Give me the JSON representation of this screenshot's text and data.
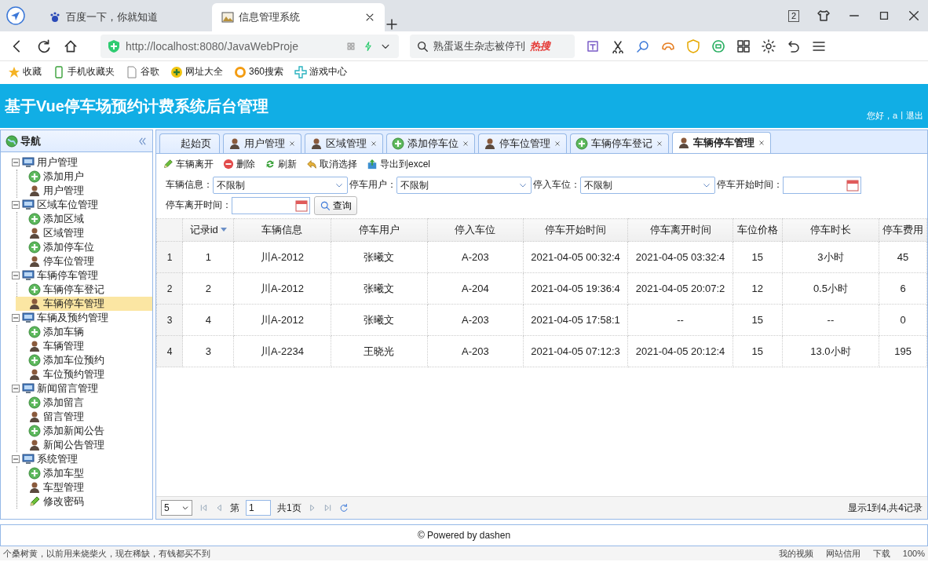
{
  "browser": {
    "tabs": [
      {
        "title": "百度一下，你就知道",
        "selected": false,
        "kind": "paw"
      },
      {
        "title": "信息管理系统",
        "selected": true,
        "kind": "picture"
      }
    ],
    "window_count": "2",
    "url": "http://localhost:8080/JavaWebProje",
    "search_hint": "熟蛋返生杂志被停刊",
    "hot": "热搜",
    "bookmarks": [
      {
        "label": "收藏",
        "kind": "star"
      },
      {
        "label": "手机收藏夹",
        "kind": "phone"
      },
      {
        "label": "谷歌",
        "kind": "page"
      },
      {
        "label": "网址大全",
        "kind": "plus"
      },
      {
        "label": "360搜索",
        "kind": "ring"
      },
      {
        "label": "游戏中心",
        "kind": "cross"
      }
    ]
  },
  "app": {
    "title": "基于Vue停车场预约计费系统后台管理",
    "greeting": "您好，a",
    "separator": "|",
    "logout": "退出"
  },
  "nav": {
    "title": "导航",
    "groups": [
      {
        "label": "用户管理",
        "expanded": true,
        "children": [
          {
            "label": "添加用户",
            "kind": "add",
            "selected": false
          },
          {
            "label": "用户管理",
            "kind": "user",
            "selected": false
          }
        ]
      },
      {
        "label": "区域车位管理",
        "expanded": true,
        "children": [
          {
            "label": "添加区域",
            "kind": "add",
            "selected": false
          },
          {
            "label": "区域管理",
            "kind": "user",
            "selected": false
          },
          {
            "label": "添加停车位",
            "kind": "add",
            "selected": false
          },
          {
            "label": "停车位管理",
            "kind": "user",
            "selected": false
          }
        ]
      },
      {
        "label": "车辆停车管理",
        "expanded": true,
        "children": [
          {
            "label": "车辆停车登记",
            "kind": "add",
            "selected": false
          },
          {
            "label": "车辆停车管理",
            "kind": "user",
            "selected": true
          }
        ]
      },
      {
        "label": "车辆及预约管理",
        "expanded": true,
        "children": [
          {
            "label": "添加车辆",
            "kind": "add",
            "selected": false
          },
          {
            "label": "车辆管理",
            "kind": "user",
            "selected": false
          },
          {
            "label": "添加车位预约",
            "kind": "add",
            "selected": false
          },
          {
            "label": "车位预约管理",
            "kind": "user",
            "selected": false
          }
        ]
      },
      {
        "label": "新闻留言管理",
        "expanded": true,
        "children": [
          {
            "label": "添加留言",
            "kind": "add",
            "selected": false
          },
          {
            "label": "留言管理",
            "kind": "user",
            "selected": false
          },
          {
            "label": "添加新闻公告",
            "kind": "add",
            "selected": false
          },
          {
            "label": "新闻公告管理",
            "kind": "user",
            "selected": false
          }
        ]
      },
      {
        "label": "系统管理",
        "expanded": true,
        "children": [
          {
            "label": "添加车型",
            "kind": "add",
            "selected": false
          },
          {
            "label": "车型管理",
            "kind": "user",
            "selected": false
          },
          {
            "label": "修改密码",
            "kind": "edit",
            "selected": false
          }
        ]
      }
    ]
  },
  "tabs": [
    {
      "label": "起始页",
      "kind": "home",
      "selected": false
    },
    {
      "label": "用户管理",
      "kind": "user",
      "selected": false
    },
    {
      "label": "区域管理",
      "kind": "user",
      "selected": false
    },
    {
      "label": "添加停车位",
      "kind": "add",
      "selected": false
    },
    {
      "label": "停车位管理",
      "kind": "user",
      "selected": false
    },
    {
      "label": "车辆停车登记",
      "kind": "add",
      "selected": false
    },
    {
      "label": "车辆停车管理",
      "kind": "user",
      "selected": true
    }
  ],
  "toolbar": [
    {
      "label": "车辆离开",
      "kind": "edit"
    },
    {
      "label": "删除",
      "kind": "delete"
    },
    {
      "label": "刷新",
      "kind": "refresh"
    },
    {
      "label": "取消选择",
      "kind": "undo"
    },
    {
      "label": "导出到excel",
      "kind": "export"
    }
  ],
  "filters": [
    {
      "label": "车辆信息：",
      "kind": "select",
      "value": "不限制"
    },
    {
      "label": "停车用户：",
      "kind": "select",
      "value": "不限制"
    },
    {
      "label": "停入车位：",
      "kind": "select",
      "value": "不限制"
    },
    {
      "label": "停车开始时间：",
      "kind": "date"
    },
    {
      "label": "停车离开时间：",
      "kind": "date"
    }
  ],
  "query_button": "查询",
  "table": {
    "columns": [
      {
        "label": "记录id",
        "sorted": true
      },
      {
        "label": "车辆信息",
        "sorted": false
      },
      {
        "label": "停车用户",
        "sorted": false
      },
      {
        "label": "停入车位",
        "sorted": false
      },
      {
        "label": "停车开始时间",
        "sorted": false
      },
      {
        "label": "停车离开时间",
        "sorted": false
      },
      {
        "label": "车位价格",
        "sorted": false
      },
      {
        "label": "停车时长",
        "sorted": false
      },
      {
        "label": "停车费用",
        "sorted": false
      }
    ],
    "rows": [
      {
        "number": "1",
        "cells": [
          "1",
          "川A-2012",
          "张曦文",
          "A-203",
          "2021-04-05 00:32:4",
          "2021-04-05 03:32:4",
          "15",
          "3小时",
          "45"
        ]
      },
      {
        "number": "2",
        "cells": [
          "2",
          "川A-2012",
          "张曦文",
          "A-204",
          "2021-04-05 19:36:4",
          "2021-04-05 20:07:2",
          "12",
          "0.5小时",
          "6"
        ]
      },
      {
        "number": "3",
        "cells": [
          "4",
          "川A-2012",
          "张曦文",
          "A-203",
          "2021-04-05 17:58:1",
          "--",
          "15",
          "--",
          "0"
        ]
      },
      {
        "number": "4",
        "cells": [
          "3",
          "川A-2234",
          "王晓光",
          "A-203",
          "2021-04-05 07:12:3",
          "2021-04-05 20:12:4",
          "15",
          "13.0小时",
          "195"
        ]
      }
    ]
  },
  "pager": {
    "page_size": "5",
    "page_prefix": "第",
    "page": "1",
    "page_total": "共1页",
    "summary": "显示1到4,共4记录"
  },
  "footer": "© Powered by dashen",
  "status_bar": {
    "news": "个桑树黄，以前用来烧柴火，现在稀缺，有钱都买不到",
    "items": [
      "我的视频",
      "网站信用",
      "下载"
    ],
    "zoom": "100%"
  }
}
